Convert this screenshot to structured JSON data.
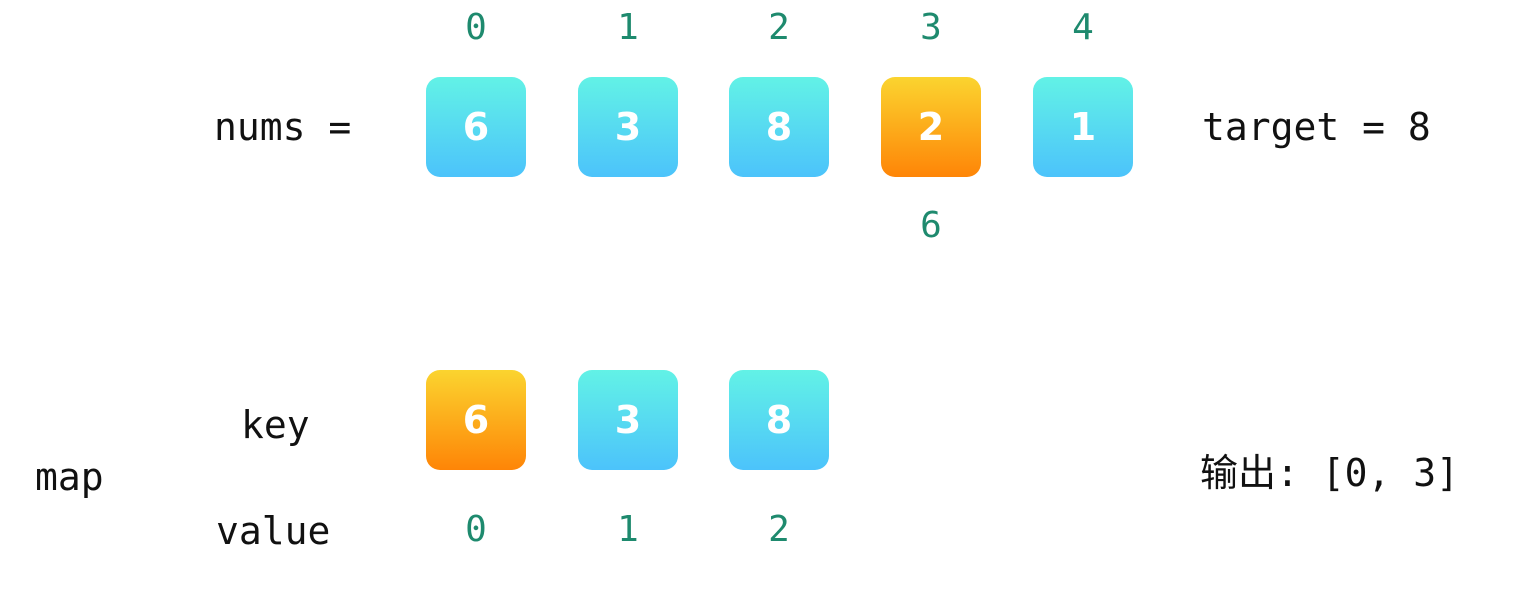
{
  "nums": {
    "label": "nums =",
    "indices": [
      "0",
      "1",
      "2",
      "3",
      "4"
    ],
    "values": [
      "6",
      "3",
      "8",
      "2",
      "1"
    ],
    "highlight_index": 3,
    "complement_label": "6"
  },
  "target": {
    "label": "target = 8"
  },
  "map": {
    "label": "map",
    "key_label": "key",
    "value_label": "value",
    "keys": [
      "6",
      "3",
      "8"
    ],
    "values": [
      "0",
      "1",
      "2"
    ],
    "highlight_index": 0
  },
  "output": {
    "label": "输出: [0, 3]"
  },
  "colors": {
    "box_normal_top": "#62f2e6",
    "box_normal_bottom": "#4cc3fb",
    "box_highlight_top": "#fbd42f",
    "box_highlight_bottom": "#fe8507",
    "index_text": "#1e8a6e",
    "label_text": "#111111"
  }
}
